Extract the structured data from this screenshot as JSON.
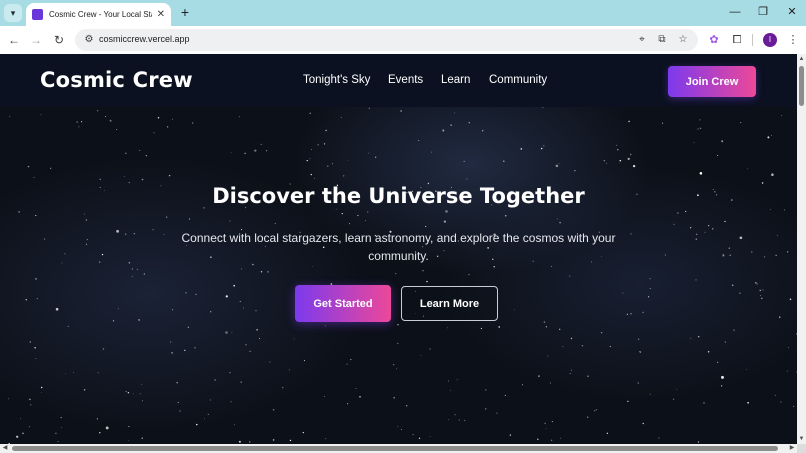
{
  "browser": {
    "tab_title": "Cosmic Crew - Your Local Starg",
    "url": "cosmiccrew.vercel.app",
    "profile_initial": "I"
  },
  "icons": {
    "tab_search": "chevron-down-icon",
    "favicon": "purple-square-favicon",
    "tab_close": "close-icon",
    "new_tab": "plus-icon",
    "minimize": "minimize-icon",
    "restore": "restore-icon",
    "close_window": "close-icon",
    "back": "arrow-left-icon",
    "forward": "arrow-right-icon",
    "reload": "reload-icon",
    "site_info": "tune-icon",
    "location": "location-pin-icon",
    "install": "install-app-icon",
    "bookmark": "star-icon",
    "extension_colorful": "colorful-extension-icon",
    "extensions": "puzzle-icon",
    "menu": "more-vertical-icon"
  },
  "site": {
    "brand": "Cosmic Crew",
    "nav": [
      "Tonight's Sky",
      "Events",
      "Learn",
      "Community"
    ],
    "cta": "Join Crew"
  },
  "hero": {
    "title": "Discover the Universe Together",
    "subtitle": "Connect with local stargazers, learn astronomy, and explore the cosmos with your community.",
    "primary_button": "Get Started",
    "secondary_button": "Learn More"
  },
  "colors": {
    "accent_start": "#7c3aed",
    "accent_end": "#ec4899",
    "header_bg": "#0b1120",
    "tabbar_bg": "#a7dce4"
  }
}
